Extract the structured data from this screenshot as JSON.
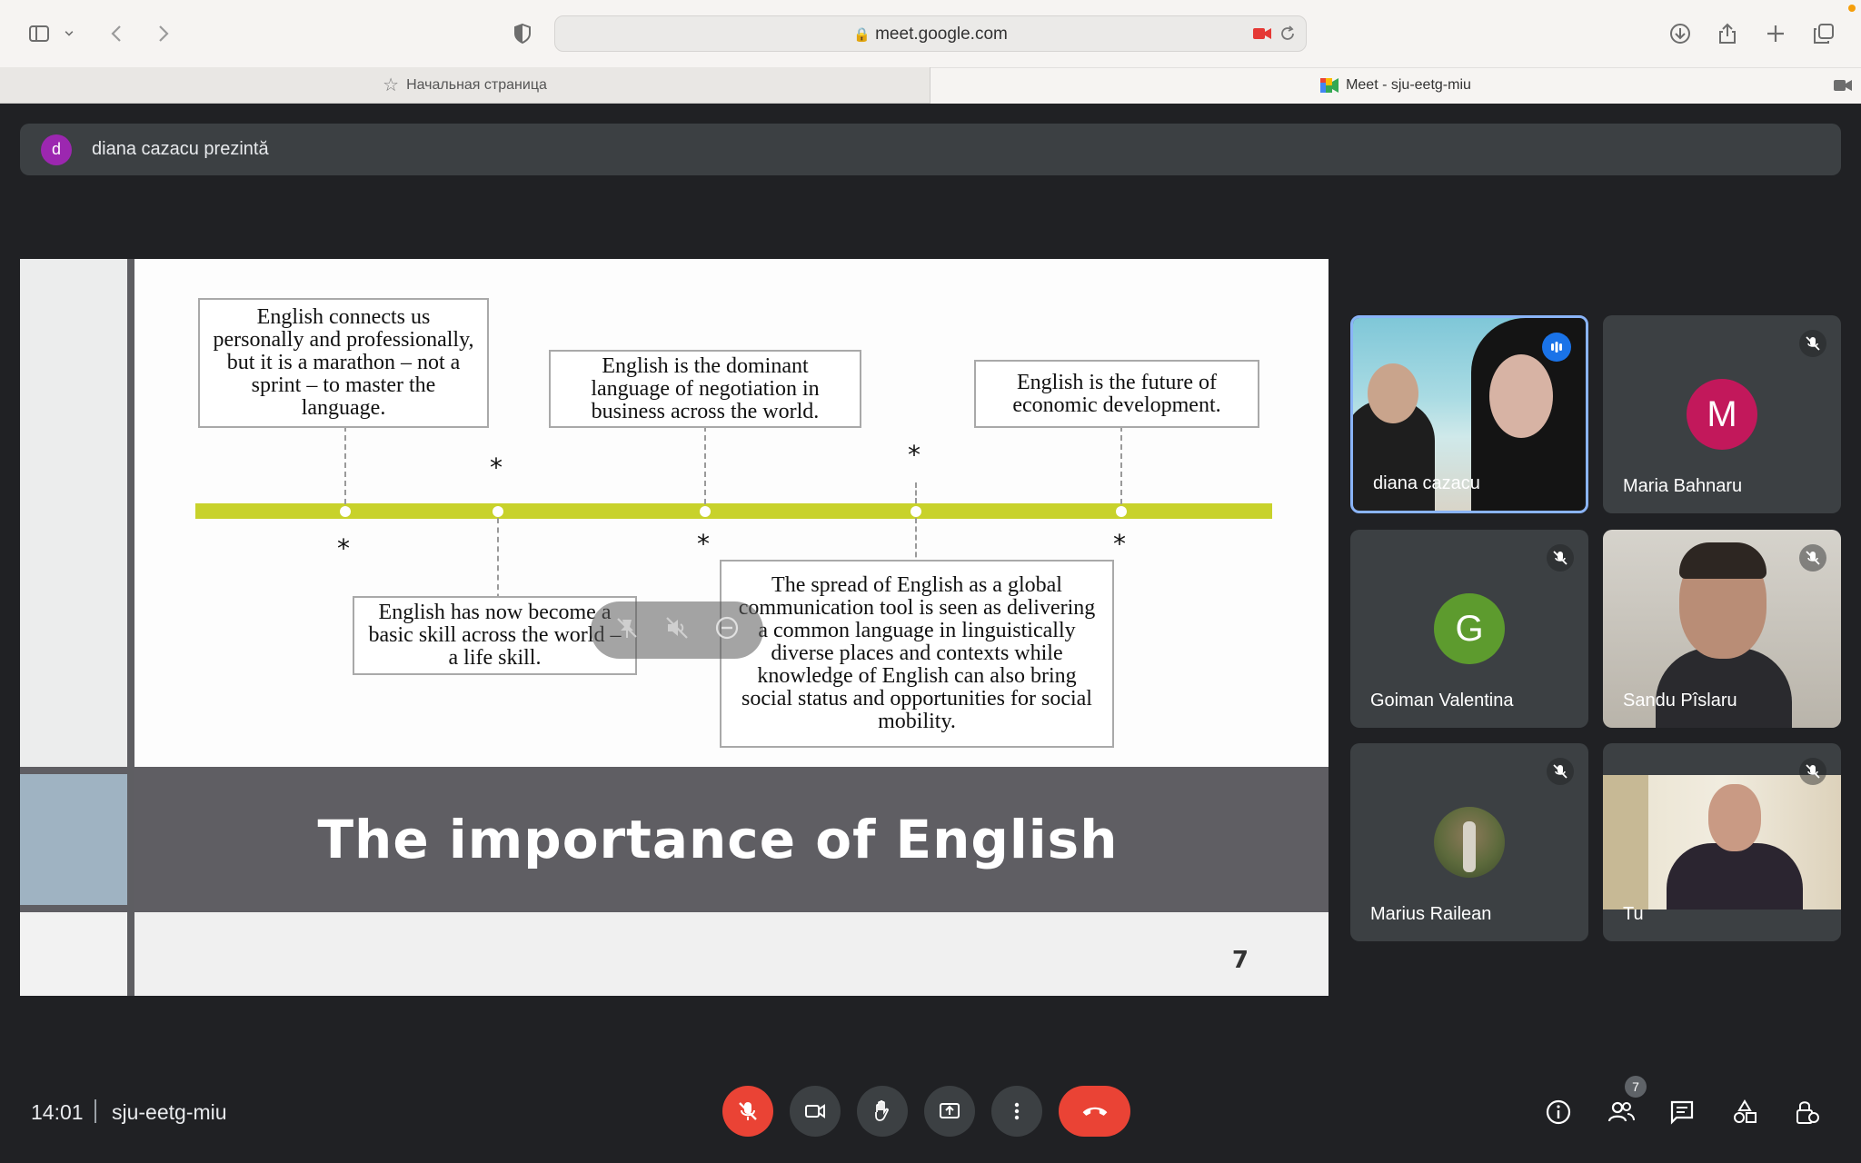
{
  "browser": {
    "url": "meet.google.com",
    "tabs": [
      {
        "label": "Начальная страница"
      },
      {
        "label": "Meet - sju-eetg-miu"
      }
    ]
  },
  "presenter": {
    "avatar_letter": "d",
    "text": "diana cazacu prezintă"
  },
  "slide": {
    "title": "The importance of English",
    "page_number": "7",
    "boxes": [
      "English connects us personally and professionally, but it is a marathon – not a sprint – to master the language.",
      "English is the dominant language of negotiation in business across the world.",
      "English is the future of economic development.",
      "English has now become a basic skill across the world – a life skill.",
      "The spread of English as a global communication tool is seen as delivering a common language in linguistically diverse places and contexts while knowledge of English can also bring social status and opportunities for social mobility."
    ],
    "star": "*"
  },
  "participants": [
    {
      "name": "diana cazacu",
      "type": "video",
      "speaking": true
    },
    {
      "name": "Maria Bahnaru",
      "avatar_letter": "M",
      "avatar_color": "#c2185b",
      "muted": true
    },
    {
      "name": "Goiman Valentina",
      "avatar_letter": "G",
      "avatar_color": "#5d9b2e",
      "muted": true
    },
    {
      "name": "Sandu Pîslaru",
      "type": "video",
      "muted": true
    },
    {
      "name": "Marius Railean",
      "type": "photo",
      "muted": true
    },
    {
      "name": "Tu",
      "type": "video",
      "muted": true
    }
  ],
  "footer": {
    "time": "14:01",
    "meeting_code": "sju-eetg-miu",
    "participant_count": "7"
  },
  "colors": {
    "background": "#202124",
    "end_call": "#ea4335",
    "timeline": "#c8d22b",
    "active_tile_border": "#8ab4f8"
  }
}
